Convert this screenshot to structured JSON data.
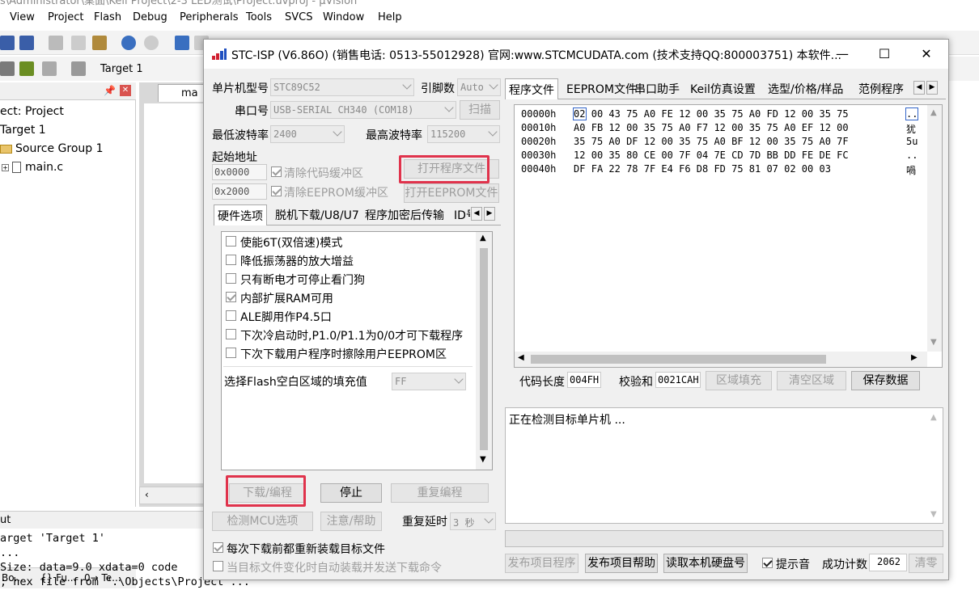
{
  "background_ide": {
    "title_fragment": "s\\Administrator\\桌面\\Keil Project\\2-3 LED测试\\Project.uvproj - µVision",
    "menu": [
      "View",
      "Project",
      "Flash",
      "Debug",
      "Peripherals",
      "Tools",
      "SVCS",
      "Window",
      "Help"
    ],
    "target_label": "Target 1",
    "project_panel": {
      "tree": [
        "ect: Project",
        "Target 1",
        "Source Group 1",
        "main.c"
      ],
      "bottom_tabs": [
        "Bo...",
        "{} Fu...",
        "0→ Te..."
      ]
    },
    "editor_tab": "ma",
    "output": {
      "header": "ut",
      "lines": [
        "arget 'Target 1'",
        "...",
        "Size: data=9.0 xdata=0 code",
        "; hex file from \".\\Objects\\Project\"..."
      ]
    }
  },
  "dialog": {
    "title": "STC-ISP (V6.86O) (销售电话: 0513-55012928) 官网:www.STCMCUDATA.com  (技术支持QQ:800003751) 本软件...",
    "window_controls": {
      "minimize": "—",
      "maximize": "☐",
      "close": "✕"
    },
    "mcu_type_label": "单片机型号",
    "mcu_type_value": "STC89C52",
    "pins_label": "引脚数",
    "pins_value": "Auto",
    "port_label": "串口号",
    "port_value": "USB-SERIAL CH340 (COM18)",
    "scan_button": "扫描",
    "min_baud_label": "最低波特率",
    "min_baud_value": "2400",
    "max_baud_label": "最高波特率",
    "max_baud_value": "115200",
    "start_addr_label": "起始地址",
    "addr1": "0x0000",
    "clear_code_buffer": "清除代码缓冲区",
    "open_program_button": "打开程序文件",
    "addr2": "0x2000",
    "clear_eeprom_buffer": "清除EEPROM缓冲区",
    "open_eeprom_button": "打开EEPROM文件",
    "left_tabs": [
      "硬件选项",
      "脱机下载/U8/U7",
      "程序加密后传输",
      "ID号"
    ],
    "hw_options": [
      {
        "label": "使能6T(双倍速)模式",
        "checked": false
      },
      {
        "label": "降低振荡器的放大增益",
        "checked": false
      },
      {
        "label": "只有断电才可停止看门狗",
        "checked": false
      },
      {
        "label": "内部扩展RAM可用",
        "checked": true
      },
      {
        "label": "ALE脚用作P4.5口",
        "checked": false
      },
      {
        "label": "下次冷启动时,P1.0/P1.1为0/0才可下载程序",
        "checked": false
      },
      {
        "label": "下次下载用户程序时擦除用户EEPROM区",
        "checked": false
      }
    ],
    "flash_fill_label": "选择Flash空白区域的填充值",
    "flash_fill_value": "FF",
    "download_button": "下载/编程",
    "stop_button": "停止",
    "reprogram_button": "重复编程",
    "detect_mcu_button": "检测MCU选项",
    "notes_button": "注意/帮助",
    "repeat_delay_label": "重复延时",
    "repeat_delay_value": "3 秒",
    "reload_before_download": "每次下载前都重新装载目标文件",
    "auto_reload_on_change": "当目标文件变化时自动装载并发送下载命令",
    "right_tabs": [
      "程序文件",
      "EEPROM文件",
      "串口助手",
      "Keil仿真设置",
      "选型/价格/样品",
      "范例程序"
    ],
    "hex_rows": [
      {
        "addr": "00000h",
        "bytes": "02 00 43 75 A0 FE 12 00 35 75 A0 FD 12 00 35 75",
        "ascii": ".."
      },
      {
        "addr": "00010h",
        "bytes": "A0 FB 12 00 35 75 A0 F7 12 00 35 75 A0 EF 12 00",
        "ascii": "犹"
      },
      {
        "addr": "00020h",
        "bytes": "35 75 A0 DF 12 00 35 75 A0 BF 12 00 35 75 A0 7F",
        "ascii": "5u"
      },
      {
        "addr": "00030h",
        "bytes": "12 00 35 80 CE 00 7F 04 7E CD 7D BB DD FE DE FC",
        "ascii": ".."
      },
      {
        "addr": "00040h",
        "bytes": "DF FA 22 78 7F E4 F6 D8 FD 75 81 07 02 00 03",
        "ascii": "喎"
      }
    ],
    "code_length_label": "代码长度",
    "code_length_value": "004FH",
    "checksum_label": "校验和",
    "checksum_value": "0021CAH",
    "fill_area_button": "区域填充",
    "clear_area_button": "清空区域",
    "save_data_button": "保存数据",
    "status_text": "正在检测目标单片机 ...",
    "publish_program_button": "发布项目程序",
    "publish_help_button": "发布项目帮助",
    "read_disk_button": "读取本机硬盘号",
    "beep_label": "提示音",
    "beep_checked": true,
    "success_count_label": "成功计数",
    "success_count_value": "2062",
    "clear_count_button": "清零",
    "colors": {
      "highlight_red": "#e0334c",
      "accent_blue": "#3264c8"
    }
  }
}
